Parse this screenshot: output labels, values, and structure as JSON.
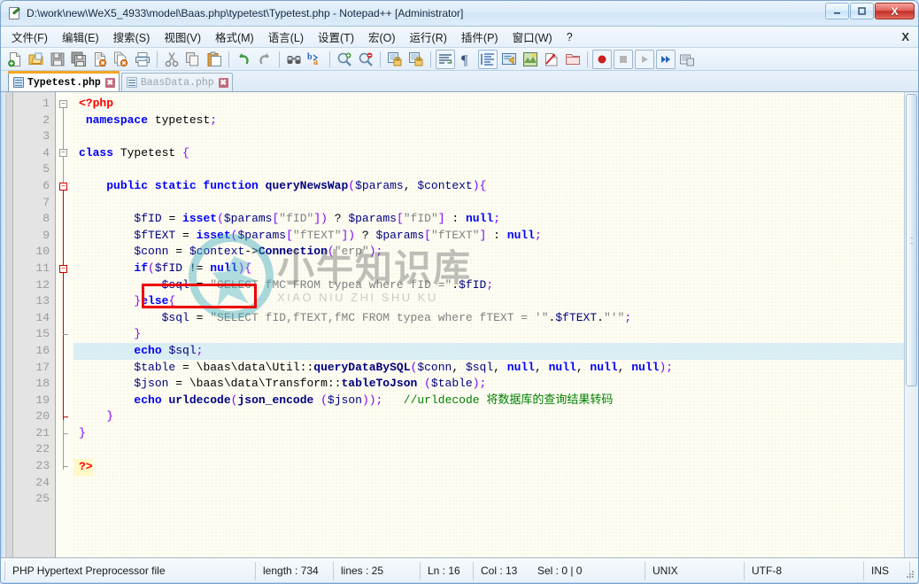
{
  "window": {
    "title": "D:\\work\\new\\WeX5_4933\\model\\Baas.php\\typetest\\Typetest.php - Notepad++ [Administrator]",
    "app_icon": "notepad-plus-plus-icon",
    "minimize_label": "—",
    "maximize_label": "❐",
    "close_label": "X"
  },
  "menubar": {
    "items": [
      {
        "label": "文件(F)",
        "name": "menu-file"
      },
      {
        "label": "编辑(E)",
        "name": "menu-edit"
      },
      {
        "label": "搜索(S)",
        "name": "menu-search"
      },
      {
        "label": "视图(V)",
        "name": "menu-view"
      },
      {
        "label": "格式(M)",
        "name": "menu-format"
      },
      {
        "label": "语言(L)",
        "name": "menu-language"
      },
      {
        "label": "设置(T)",
        "name": "menu-settings"
      },
      {
        "label": "宏(O)",
        "name": "menu-macro"
      },
      {
        "label": "运行(R)",
        "name": "menu-run"
      },
      {
        "label": "插件(P)",
        "name": "menu-plugins"
      },
      {
        "label": "窗口(W)",
        "name": "menu-window"
      },
      {
        "label": "?",
        "name": "menu-help"
      }
    ],
    "close_document_label": "X"
  },
  "toolbar": {
    "icons": [
      "new-file-icon",
      "open-folder-icon",
      "save-icon",
      "save-all-icon",
      "close-file-icon",
      "close-all-files-icon",
      "print-icon",
      "sep",
      "cut-icon",
      "copy-icon",
      "paste-icon",
      "sep",
      "undo-icon",
      "redo-icon",
      "sep",
      "find-icon",
      "replace-icon",
      "sep",
      "zoom-in-icon",
      "zoom-out-icon",
      "sep",
      "sync-vertical-scroll-icon",
      "sync-horizontal-scroll-icon",
      "sep",
      "word-wrap-icon",
      "show-all-characters-icon",
      "show-indent-guide-icon",
      "user-defined-language-icon",
      "document-map-icon",
      "function-list-icon",
      "folder-as-workspace-icon",
      "sep",
      "record-macro-icon",
      "stop-record-macro-icon",
      "play-macro-icon",
      "run-macro-multiple-icon",
      "run-icon"
    ]
  },
  "tabs": [
    {
      "label": "Typetest.php",
      "active": true,
      "close_label": "✖",
      "name": "tab-typetest-php"
    },
    {
      "label": "BaasData.php",
      "active": false,
      "close_label": "✖",
      "name": "tab-baasdata-php"
    }
  ],
  "editor": {
    "total_lines": 25,
    "current_line": 16,
    "lines": [
      {
        "n": 1,
        "tokens": [
          {
            "t": "<?php",
            "c": "php"
          }
        ]
      },
      {
        "n": 2,
        "tokens": [
          {
            "t": " ",
            "c": "plain"
          },
          {
            "t": "namespace",
            "c": "kw"
          },
          {
            "t": " typetest",
            "c": "plain"
          },
          {
            "t": ";",
            "c": "punct"
          }
        ]
      },
      {
        "n": 3,
        "tokens": []
      },
      {
        "n": 4,
        "tokens": [
          {
            "t": "class",
            "c": "kw"
          },
          {
            "t": " Typetest ",
            "c": "plain"
          },
          {
            "t": "{",
            "c": "punct"
          }
        ]
      },
      {
        "n": 5,
        "tokens": []
      },
      {
        "n": 6,
        "tokens": [
          {
            "t": "    ",
            "c": "plain"
          },
          {
            "t": "public static function",
            "c": "kw"
          },
          {
            "t": " ",
            "c": "plain"
          },
          {
            "t": "queryNewsWap",
            "c": "fn"
          },
          {
            "t": "(",
            "c": "punct"
          },
          {
            "t": "$params",
            "c": "var"
          },
          {
            "t": ", ",
            "c": "plain"
          },
          {
            "t": "$context",
            "c": "var"
          },
          {
            "t": ")",
            "c": "punct"
          },
          {
            "t": "{",
            "c": "punct"
          }
        ]
      },
      {
        "n": 7,
        "tokens": []
      },
      {
        "n": 8,
        "tokens": [
          {
            "t": "        ",
            "c": "plain"
          },
          {
            "t": "$fID",
            "c": "var"
          },
          {
            "t": " = ",
            "c": "plain"
          },
          {
            "t": "isset",
            "c": "kw"
          },
          {
            "t": "(",
            "c": "punct"
          },
          {
            "t": "$params",
            "c": "var"
          },
          {
            "t": "[",
            "c": "punct"
          },
          {
            "t": "\"fID\"",
            "c": "str"
          },
          {
            "t": "])",
            "c": "punct"
          },
          {
            "t": " ? ",
            "c": "plain"
          },
          {
            "t": "$params",
            "c": "var"
          },
          {
            "t": "[",
            "c": "punct"
          },
          {
            "t": "\"fID\"",
            "c": "str"
          },
          {
            "t": "]",
            "c": "punct"
          },
          {
            "t": " : ",
            "c": "plain"
          },
          {
            "t": "null",
            "c": "kw"
          },
          {
            "t": ";",
            "c": "punct"
          }
        ]
      },
      {
        "n": 9,
        "tokens": [
          {
            "t": "        ",
            "c": "plain"
          },
          {
            "t": "$fTEXT",
            "c": "var"
          },
          {
            "t": " = ",
            "c": "plain"
          },
          {
            "t": "isset",
            "c": "kw"
          },
          {
            "t": "(",
            "c": "punct"
          },
          {
            "t": "$params",
            "c": "var"
          },
          {
            "t": "[",
            "c": "punct"
          },
          {
            "t": "\"fTEXT\"",
            "c": "str"
          },
          {
            "t": "])",
            "c": "punct"
          },
          {
            "t": " ? ",
            "c": "plain"
          },
          {
            "t": "$params",
            "c": "var"
          },
          {
            "t": "[",
            "c": "punct"
          },
          {
            "t": "\"fTEXT\"",
            "c": "str"
          },
          {
            "t": "]",
            "c": "punct"
          },
          {
            "t": " : ",
            "c": "plain"
          },
          {
            "t": "null",
            "c": "kw"
          },
          {
            "t": ";",
            "c": "punct"
          }
        ]
      },
      {
        "n": 10,
        "tokens": [
          {
            "t": "        ",
            "c": "plain"
          },
          {
            "t": "$conn",
            "c": "var"
          },
          {
            "t": " = ",
            "c": "plain"
          },
          {
            "t": "$context",
            "c": "var"
          },
          {
            "t": "->",
            "c": "plain"
          },
          {
            "t": "Connection",
            "c": "fn"
          },
          {
            "t": "(",
            "c": "punct"
          },
          {
            "t": "\"erp\"",
            "c": "str"
          },
          {
            "t": ")",
            "c": "punct"
          },
          {
            "t": ";",
            "c": "punct"
          }
        ]
      },
      {
        "n": 11,
        "tokens": [
          {
            "t": "        ",
            "c": "plain"
          },
          {
            "t": "if",
            "c": "kw"
          },
          {
            "t": "(",
            "c": "punct"
          },
          {
            "t": "$fID",
            "c": "var"
          },
          {
            "t": " != ",
            "c": "plain"
          },
          {
            "t": "null",
            "c": "kw"
          },
          {
            "t": ")",
            "c": "punct"
          },
          {
            "t": "{",
            "c": "punct"
          }
        ]
      },
      {
        "n": 12,
        "tokens": [
          {
            "t": "            ",
            "c": "plain"
          },
          {
            "t": "$sql",
            "c": "var"
          },
          {
            "t": " = ",
            "c": "plain"
          },
          {
            "t": "\"SELECT fMC FROM typea where fID =\"",
            "c": "str"
          },
          {
            "t": ".",
            "c": "plain"
          },
          {
            "t": "$fID",
            "c": "var"
          },
          {
            "t": ";",
            "c": "punct"
          }
        ]
      },
      {
        "n": 13,
        "tokens": [
          {
            "t": "        ",
            "c": "plain"
          },
          {
            "t": "}",
            "c": "punct"
          },
          {
            "t": "else",
            "c": "kw"
          },
          {
            "t": "{",
            "c": "punct"
          }
        ]
      },
      {
        "n": 14,
        "tokens": [
          {
            "t": "            ",
            "c": "plain"
          },
          {
            "t": "$sql",
            "c": "var"
          },
          {
            "t": " = ",
            "c": "plain"
          },
          {
            "t": "\"SELECT fID,fTEXT,fMC FROM typea where fTEXT = '\"",
            "c": "str"
          },
          {
            "t": ".",
            "c": "plain"
          },
          {
            "t": "$fTEXT",
            "c": "var"
          },
          {
            "t": ".",
            "c": "plain"
          },
          {
            "t": "\"'\"",
            "c": "str"
          },
          {
            "t": ";",
            "c": "punct"
          }
        ]
      },
      {
        "n": 15,
        "tokens": [
          {
            "t": "        ",
            "c": "plain"
          },
          {
            "t": "}",
            "c": "punct"
          }
        ]
      },
      {
        "n": 16,
        "tokens": [
          {
            "t": "        ",
            "c": "plain"
          },
          {
            "t": "echo",
            "c": "kw"
          },
          {
            "t": " ",
            "c": "plain"
          },
          {
            "t": "$sql",
            "c": "var"
          },
          {
            "t": ";",
            "c": "punct"
          }
        ]
      },
      {
        "n": 17,
        "tokens": [
          {
            "t": "        ",
            "c": "plain"
          },
          {
            "t": "$table",
            "c": "var"
          },
          {
            "t": " = ",
            "c": "plain"
          },
          {
            "t": "\\baas\\data\\Util",
            "c": "plain"
          },
          {
            "t": "::",
            "c": "plain"
          },
          {
            "t": "queryDataBySQL",
            "c": "fn"
          },
          {
            "t": "(",
            "c": "punct"
          },
          {
            "t": "$conn",
            "c": "var"
          },
          {
            "t": ", ",
            "c": "plain"
          },
          {
            "t": "$sql",
            "c": "var"
          },
          {
            "t": ", ",
            "c": "plain"
          },
          {
            "t": "null",
            "c": "kw"
          },
          {
            "t": ", ",
            "c": "plain"
          },
          {
            "t": "null",
            "c": "kw"
          },
          {
            "t": ", ",
            "c": "plain"
          },
          {
            "t": "null",
            "c": "kw"
          },
          {
            "t": ", ",
            "c": "plain"
          },
          {
            "t": "null",
            "c": "kw"
          },
          {
            "t": ")",
            "c": "punct"
          },
          {
            "t": ";",
            "c": "punct"
          }
        ]
      },
      {
        "n": 18,
        "tokens": [
          {
            "t": "        ",
            "c": "plain"
          },
          {
            "t": "$json",
            "c": "var"
          },
          {
            "t": " = ",
            "c": "plain"
          },
          {
            "t": "\\baas\\data\\Transform",
            "c": "plain"
          },
          {
            "t": "::",
            "c": "plain"
          },
          {
            "t": "tableToJson",
            "c": "fn"
          },
          {
            "t": " (",
            "c": "punct"
          },
          {
            "t": "$table",
            "c": "var"
          },
          {
            "t": ")",
            "c": "punct"
          },
          {
            "t": ";",
            "c": "punct"
          }
        ]
      },
      {
        "n": 19,
        "tokens": [
          {
            "t": "        ",
            "c": "plain"
          },
          {
            "t": "echo",
            "c": "kw"
          },
          {
            "t": " ",
            "c": "plain"
          },
          {
            "t": "urldecode",
            "c": "fn"
          },
          {
            "t": "(",
            "c": "punct"
          },
          {
            "t": "json_encode",
            "c": "fn"
          },
          {
            "t": " (",
            "c": "punct"
          },
          {
            "t": "$json",
            "c": "var"
          },
          {
            "t": "))",
            "c": "punct"
          },
          {
            "t": ";",
            "c": "punct"
          },
          {
            "t": "   ",
            "c": "plain"
          },
          {
            "t": "//urldecode 将数据库的查询结果转码",
            "c": "cmt"
          }
        ]
      },
      {
        "n": 20,
        "tokens": [
          {
            "t": "    ",
            "c": "plain"
          },
          {
            "t": "}",
            "c": "punct"
          }
        ]
      },
      {
        "n": 21,
        "tokens": [
          {
            "t": "}",
            "c": "punct"
          }
        ]
      },
      {
        "n": 22,
        "tokens": []
      },
      {
        "n": 23,
        "tokens": [
          {
            "t": "?>",
            "c": "php"
          }
        ]
      },
      {
        "n": 24,
        "tokens": []
      },
      {
        "n": 25,
        "tokens": []
      }
    ],
    "annotation": {
      "type": "red-rectangle",
      "target_text": "echo $sql;",
      "color": "#ee0000"
    },
    "watermark": {
      "cn": "小牛知识库",
      "en": "XIAO NIU ZHI SHU KU",
      "color": "#3aa8bd"
    }
  },
  "statusbar": {
    "file_type": "PHP Hypertext Preprocessor file",
    "length": "length : 734",
    "lines": "lines : 25",
    "ln": "Ln : 16",
    "col": "Col : 13",
    "sel": "Sel : 0 | 0",
    "eol": "UNIX",
    "encoding": "UTF-8",
    "insert_mode": "INS"
  }
}
